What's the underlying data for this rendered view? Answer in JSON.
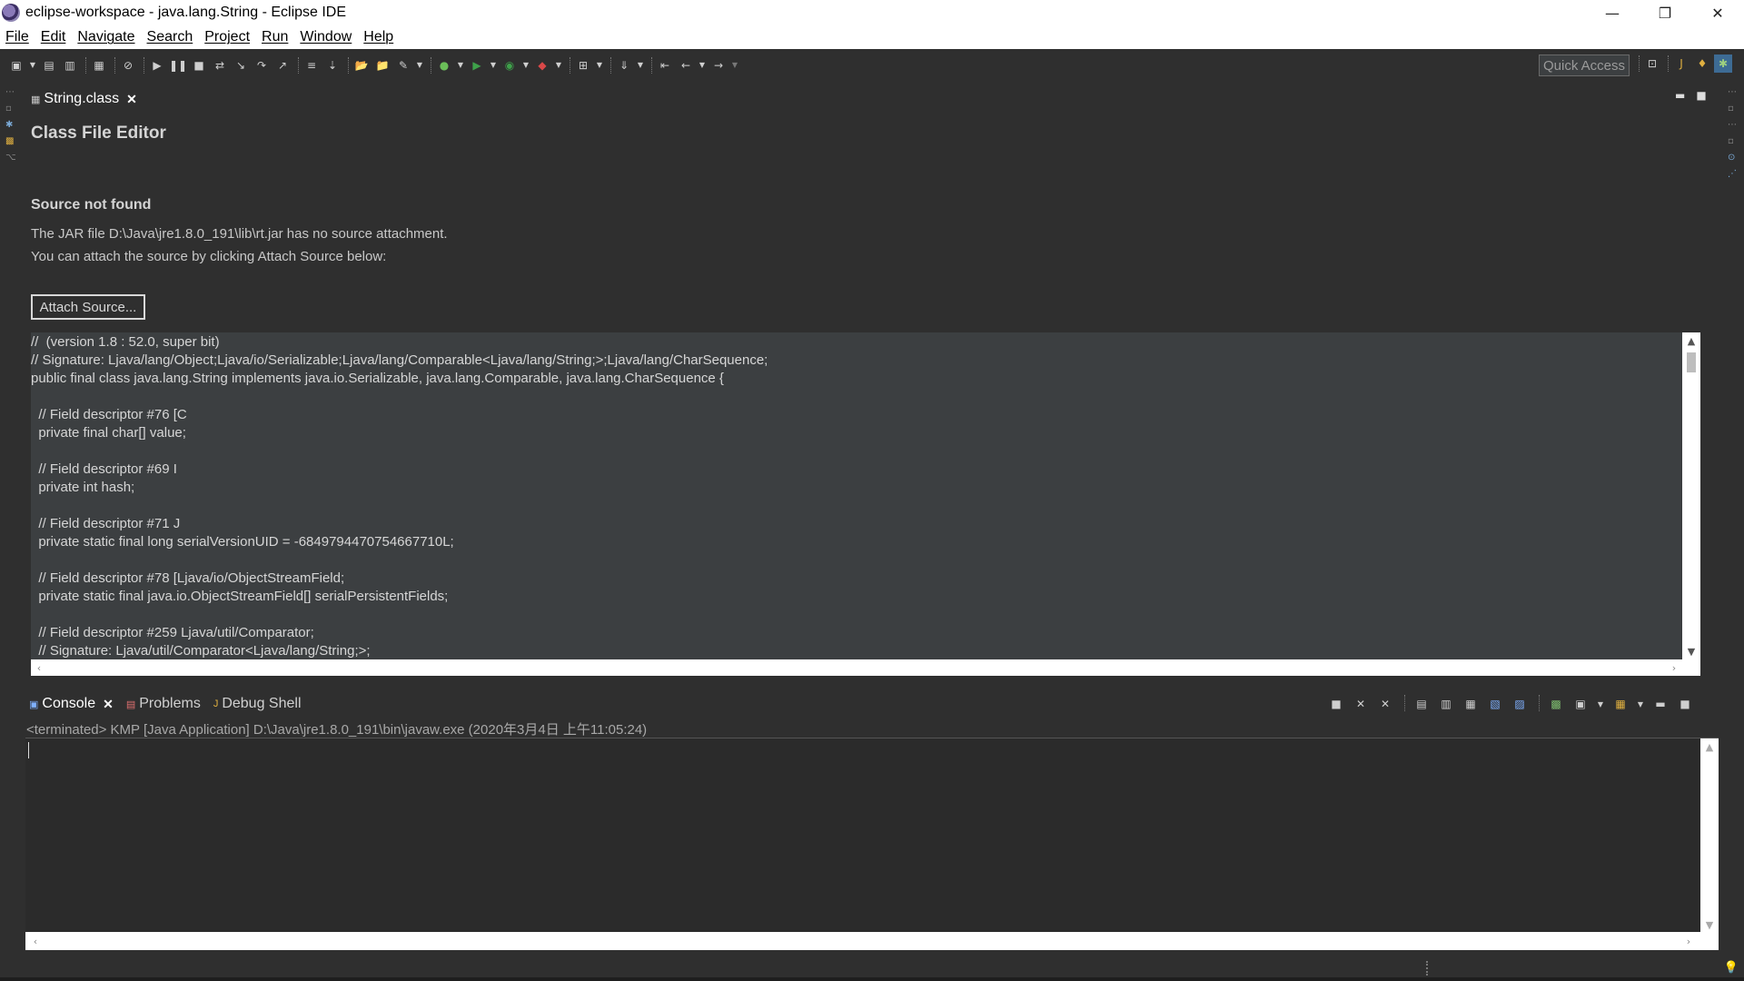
{
  "window": {
    "title": "eclipse-workspace - java.lang.String - Eclipse IDE",
    "controls": {
      "minimize": "—",
      "restore": "❐",
      "close": "✕"
    }
  },
  "menu": [
    "File",
    "Edit",
    "Navigate",
    "Search",
    "Project",
    "Run",
    "Window",
    "Help"
  ],
  "toolbar": {
    "quick_access": "Quick Access"
  },
  "editor": {
    "tab_label": "String.class",
    "tab_close": "✕",
    "heading": "Class File Editor",
    "source_not_found": "Source not found",
    "message_line1": "The JAR file D:\\Java\\jre1.8.0_191\\lib\\rt.jar has no source attachment.",
    "message_line2": "You can attach the source by clicking Attach Source below:",
    "attach_button": "Attach Source...",
    "code": [
      "//  (version 1.8 : 52.0, super bit)",
      "// Signature: Ljava/lang/Object;Ljava/io/Serializable;Ljava/lang/Comparable<Ljava/lang/String;>;Ljava/lang/CharSequence;",
      "public final class java.lang.String implements java.io.Serializable, java.lang.Comparable, java.lang.CharSequence {",
      "",
      "  // Field descriptor #76 [C",
      "  private final char[] value;",
      "",
      "  // Field descriptor #69 I",
      "  private int hash;",
      "",
      "  // Field descriptor #71 J",
      "  private static final long serialVersionUID = -6849794470754667710L;",
      "",
      "  // Field descriptor #78 [Ljava/io/ObjectStreamField;",
      "  private static final java.io.ObjectStreamField[] serialPersistentFields;",
      "",
      "  // Field descriptor #259 Ljava/util/Comparator;",
      "  // Signature: Ljava/util/Comparator<Ljava/lang/String;>;"
    ]
  },
  "console": {
    "tabs": [
      "Console",
      "Problems",
      "Debug Shell"
    ],
    "tab_close": "✕",
    "status": "<terminated> KMP [Java Application] D:\\Java\\jre1.8.0_191\\bin\\javaw.exe (2020年3月4日 上午11:05:24)"
  },
  "colors": {
    "background": "#2f2f2f",
    "code_background": "#3c3f41",
    "console_background": "#2b2b2b",
    "accent_blue": "#7fb0ff"
  }
}
